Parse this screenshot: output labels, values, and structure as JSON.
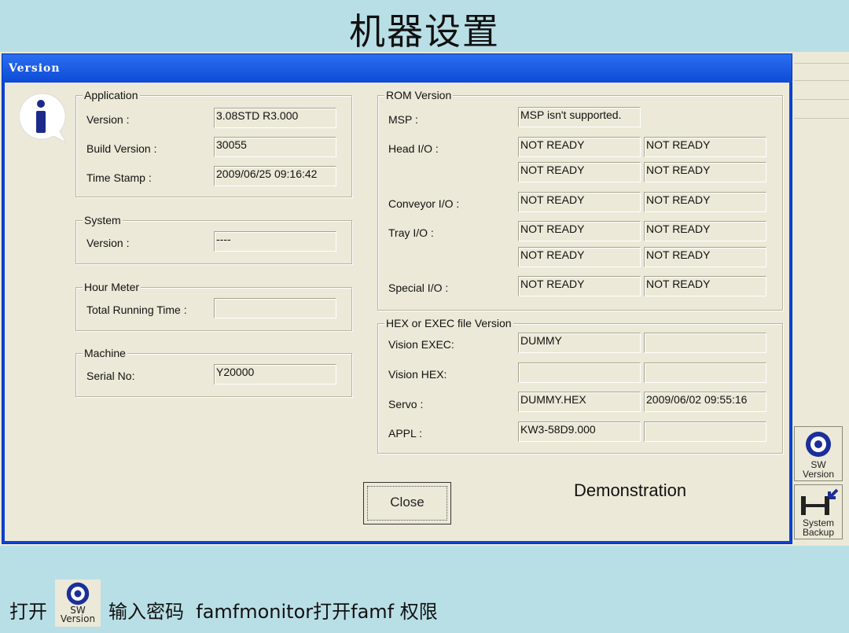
{
  "slide": {
    "title": "机器设置",
    "footer_open": "打开",
    "footer_icon_line1": "SW",
    "footer_icon_line2": "Version",
    "footer_instruction": "输入密码  famfmonitor打开famf 权限"
  },
  "dialog": {
    "title": "Version",
    "application": {
      "label": "Application",
      "version_label": "Version :",
      "version_value": "3.08STD R3.000",
      "build_label": "Build Version :",
      "build_value": "30055",
      "timestamp_label": "Time Stamp :",
      "timestamp_value": "2009/06/25 09:16:42"
    },
    "system": {
      "label": "System",
      "version_label": "Version :",
      "version_value": "----"
    },
    "hour_meter": {
      "label": "Hour Meter",
      "total_label": "Total Running Time :",
      "total_value": ""
    },
    "machine": {
      "label": "Machine",
      "serial_label": "Serial No:",
      "serial_value": "Y20000"
    },
    "rom": {
      "label": "ROM Version",
      "msp_label": "MSP :",
      "msp_value": "MSP isn't supported.",
      "head_label": "Head I/O :",
      "head_values": [
        "NOT READY",
        "NOT READY",
        "NOT READY",
        "NOT READY"
      ],
      "conveyor_label": "Conveyor I/O :",
      "conveyor_values": [
        "NOT READY",
        "NOT READY"
      ],
      "tray_label": "Tray I/O :",
      "tray_values": [
        "NOT READY",
        "NOT READY",
        "NOT READY",
        "NOT READY"
      ],
      "special_label": "Special I/O :",
      "special_values": [
        "NOT READY",
        "NOT READY"
      ]
    },
    "hex": {
      "label": "HEX or EXEC file Version",
      "vision_exec_label": "Vision EXEC:",
      "vision_exec_values": [
        "DUMMY",
        ""
      ],
      "vision_hex_label": "Vision HEX:",
      "vision_hex_values": [
        "",
        ""
      ],
      "servo_label": "Servo :",
      "servo_values": [
        "DUMMY.HEX",
        "2009/06/02 09:55:16"
      ],
      "appl_label": "APPL :",
      "appl_values": [
        "KW3-58D9.000",
        ""
      ]
    },
    "close_label": "Close",
    "mode_text": "Demonstration"
  },
  "side_buttons": {
    "sw_line1": "SW",
    "sw_line2": "Version",
    "backup_line1": "System",
    "backup_line2": "Backup"
  },
  "colors": {
    "titlebar": "#0d4bd6",
    "dialog_bg": "#ece9d8",
    "slide_bg": "#b9dfe6"
  }
}
